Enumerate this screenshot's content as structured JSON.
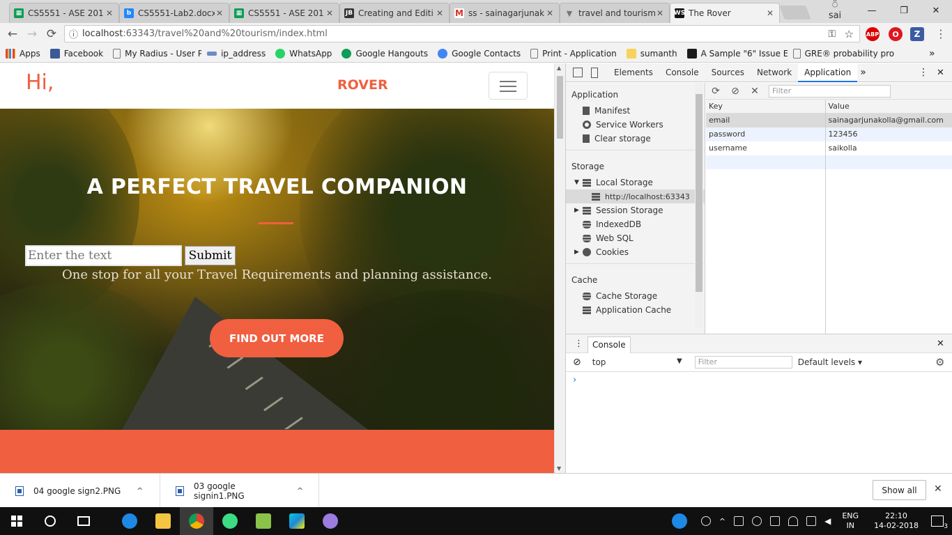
{
  "tabs": [
    {
      "title": "CS5551 - ASE 201",
      "icon": "sheets-icon",
      "color": "#0f9d58"
    },
    {
      "title": "CS5551-Lab2.docx",
      "icon": "box-icon",
      "color": "#2486fc"
    },
    {
      "title": "CS5551 - ASE 201",
      "icon": "sheets-icon",
      "color": "#0f9d58"
    },
    {
      "title": "Creating and Editi",
      "icon": "jetbrains-icon",
      "color": "#333333"
    },
    {
      "title": "ss - sainagarjunak",
      "icon": "gmail-icon",
      "color": "#d93025"
    },
    {
      "title": "travel and tourism",
      "icon": "filter-icon",
      "color": "#777777"
    },
    {
      "title": "The Rover",
      "icon": "webstorm-icon",
      "color": "#111111"
    }
  ],
  "window": {
    "profile": "sai",
    "minimize": "—",
    "restore": "❐",
    "close": "✕"
  },
  "toolbar": {
    "url_host": "localhost",
    "url_rest": ":63343/travel%20and%20tourism/index.html",
    "info_glyph": "ⓘ",
    "key_glyph": "⚿",
    "star_glyph": "☆",
    "ext_abp": "ABP",
    "ext_o": "O",
    "ext_z": "Z",
    "menu_glyph": "⋮",
    "back_glyph": "←",
    "forward_glyph": "→",
    "reload_glyph": "⟳"
  },
  "bookmarks": [
    {
      "label": "Apps",
      "icon": "apps-icon",
      "color": "#e94235"
    },
    {
      "label": "Facebook",
      "icon": "facebook-icon",
      "color": "#3b5998"
    },
    {
      "label": "My Radius - User Por",
      "icon": "page-icon",
      "color": "#ffffff"
    },
    {
      "label": "ip_address",
      "icon": "fiber-icon",
      "color": "#6b8cc7"
    },
    {
      "label": "WhatsApp",
      "icon": "whatsapp-icon",
      "color": "#25d366"
    },
    {
      "label": "Google Hangouts",
      "icon": "hangouts-icon",
      "color": "#0f9d58"
    },
    {
      "label": "Google Contacts",
      "icon": "contacts-icon",
      "color": "#4285f4"
    },
    {
      "label": "Print - Application",
      "icon": "page-icon",
      "color": "#ffffff"
    },
    {
      "label": "sumanth",
      "icon": "folder-icon",
      "color": "#f7d35c"
    },
    {
      "label": "A Sample \"6\" Issue E",
      "icon": "asterisk-icon",
      "color": "#1b1b1b"
    },
    {
      "label": "GRE® probability pro",
      "icon": "page-icon",
      "color": "#ffffff"
    }
  ],
  "bookmarks_more": "»",
  "site": {
    "greeting": "Hi,",
    "brand": "ROVER",
    "hero_title": "A PERFECT TRAVEL COMPANION",
    "input_placeholder": "Enter the text",
    "submit_label": "Submit",
    "subtitle": "One stop for all your Travel Requirements and planning assistance.",
    "cta_label": "FIND OUT MORE",
    "accent": "#f05f40"
  },
  "devtools": {
    "tabs": [
      "Elements",
      "Console",
      "Sources",
      "Network",
      "Application"
    ],
    "active_tab": "Application",
    "more": "»",
    "menu": "⋮",
    "close": "✕",
    "sidebar": {
      "application_header": "Application",
      "application_items": [
        "Manifest",
        "Service Workers",
        "Clear storage"
      ],
      "storage_header": "Storage",
      "local_storage": "Local Storage",
      "local_origin": "http://localhost:63343",
      "session_storage": "Session Storage",
      "indexeddb": "IndexedDB",
      "websql": "Web SQL",
      "cookies": "Cookies",
      "cache_header": "Cache",
      "cache_storage": "Cache Storage",
      "app_cache": "Application Cache"
    },
    "storage_toolbar": {
      "refresh": "⟳",
      "clear": "⊘",
      "delete": "✕",
      "filter_placeholder": "Filter"
    },
    "table": {
      "headers": [
        "Key",
        "Value"
      ],
      "rows": [
        {
          "key": "email",
          "value": "sainagarjunakolla@gmail.com"
        },
        {
          "key": "password",
          "value": "123456"
        },
        {
          "key": "username",
          "value": "saikolla"
        }
      ]
    },
    "console": {
      "tab": "Console",
      "context": "top",
      "filter_placeholder": "Filter",
      "levels": "Default levels ▾",
      "prompt": "›",
      "close": "✕",
      "block": "⊘",
      "gear": "⚙",
      "dots": "⋮",
      "dropdown": "▼"
    }
  },
  "downloads": [
    {
      "name": "04 google sign2.PNG",
      "chev": "^"
    },
    {
      "name": "03 google signin1.PNG",
      "chev": "^"
    }
  ],
  "downloads_showall": "Show all",
  "downloads_close": "✕",
  "taskbar": {
    "apps": [
      "windows-icon",
      "cortana-icon",
      "taskview-icon",
      "edge-icon",
      "explorer-icon",
      "chrome-icon",
      "android-studio-icon",
      "notepad-icon",
      "webstorm-icon",
      "git-icon"
    ],
    "lang_top": "ENG",
    "lang_bottom": "IN",
    "time": "22:10",
    "date": "14-02-2018",
    "notifications": "3"
  }
}
